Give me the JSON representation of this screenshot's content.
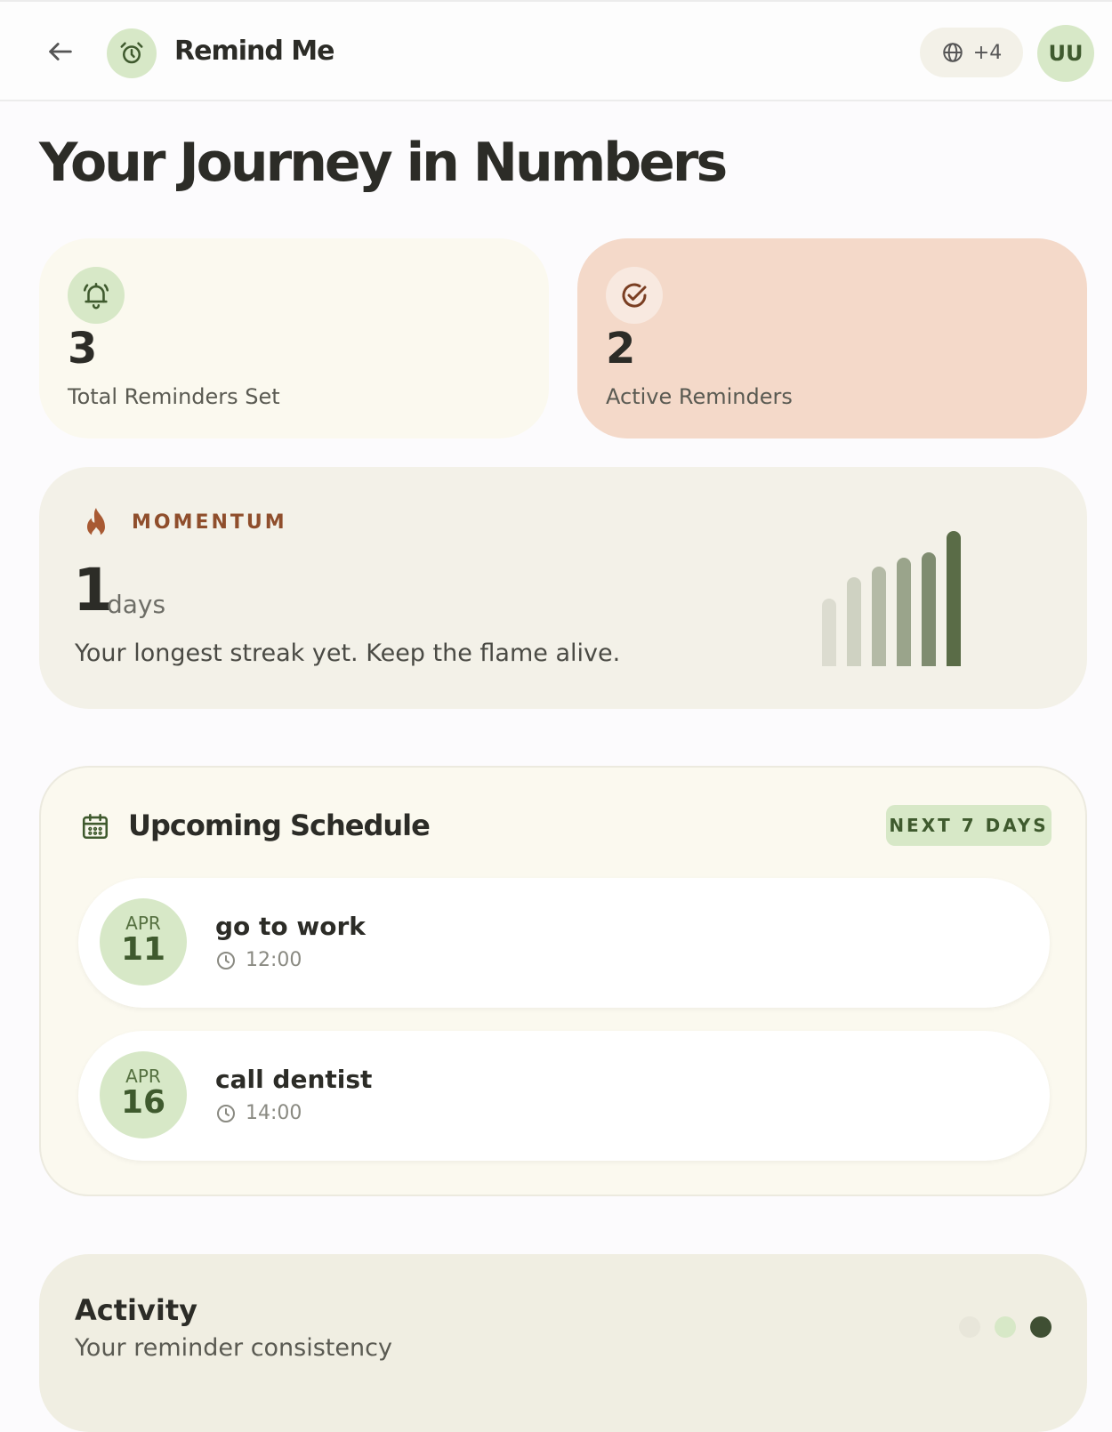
{
  "header": {
    "title": "Remind Me",
    "lang_badge": "+4",
    "avatar_initials": "UU"
  },
  "page_title": "Your Journey in Numbers",
  "stats": {
    "total": {
      "value": "3",
      "label": "Total Reminders Set",
      "icon": "bell-icon"
    },
    "active": {
      "value": "2",
      "label": "Active Reminders",
      "icon": "check-circle-icon"
    }
  },
  "momentum": {
    "label": "MOMENTUM",
    "value": "1",
    "unit": "days",
    "text": "Your longest streak yet. Keep the flame alive.",
    "bars": [
      0.5,
      0.66,
      0.74,
      0.8,
      0.84,
      1.0
    ],
    "bar_colors": [
      "#dcdcd0",
      "#cfd2c2",
      "#b4baa6",
      "#9aa48b",
      "#7f8c70",
      "#5a6c47"
    ]
  },
  "schedule": {
    "title": "Upcoming Schedule",
    "badge": "NEXT 7 DAYS",
    "events": [
      {
        "month": "APR",
        "day": "11",
        "title": "go to work",
        "time": "12:00"
      },
      {
        "month": "APR",
        "day": "16",
        "title": "call dentist",
        "time": "14:00"
      }
    ]
  },
  "activity": {
    "title": "Activity",
    "subtitle": "Your reminder consistency",
    "dot_colors": [
      "#e8e6da",
      "#d7e8c7",
      "#3f4f33"
    ]
  },
  "colors": {
    "accent_green": "#d7e8c7",
    "dark_green": "#3f5a2e",
    "flame": "#8f4e2c",
    "peach": "#f4d9c9"
  }
}
